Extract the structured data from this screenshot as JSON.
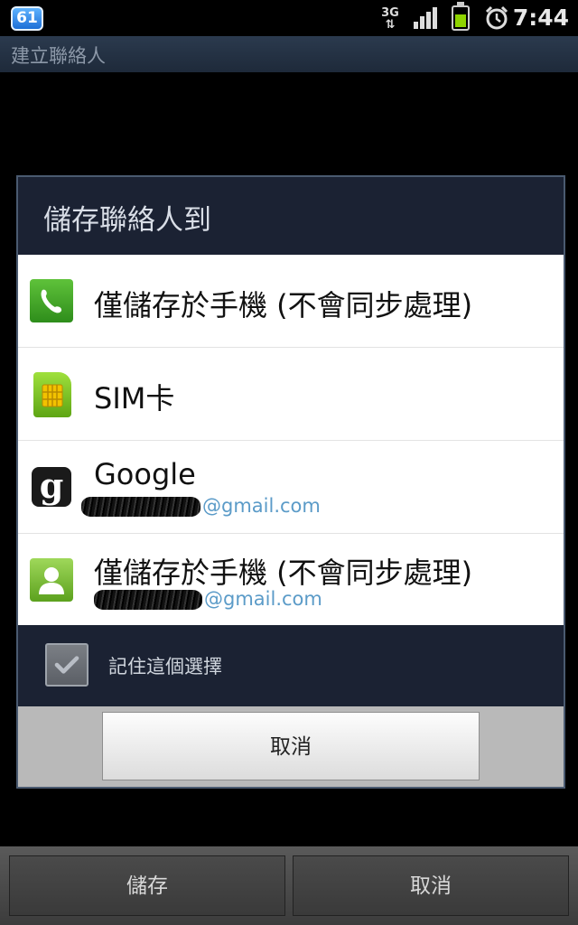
{
  "status_bar": {
    "notification_count": "61",
    "network_type": "3G",
    "time": "7:44",
    "icons": [
      "notification-badge-icon",
      "3g-data-icon",
      "signal-strength-icon",
      "battery-icon",
      "alarm-clock-icon"
    ]
  },
  "title_bar": {
    "title": "建立聯絡人"
  },
  "dialog": {
    "title": "儲存聯絡人到",
    "items": [
      {
        "label": "僅儲存於手機 (不會同步處理)",
        "account_suffix": "",
        "icon": "phone-icon"
      },
      {
        "label": "SIM卡",
        "account_suffix": "",
        "icon": "sim-card-icon"
      },
      {
        "label": "Google",
        "account_suffix": "@gmail.com",
        "icon": "google-icon"
      },
      {
        "label": "僅儲存於手機 (不會同步處理)",
        "account_suffix": "@gmail.com",
        "icon": "contact-icon"
      }
    ],
    "remember_label": "記住這個選擇",
    "remember_checked": true,
    "cancel_label": "取消"
  },
  "bottom_bar": {
    "save_label": "儲存",
    "cancel_label": "取消"
  },
  "colors": {
    "accent_link": "#5b9bc8",
    "dialog_bg": "#1b2233",
    "list_bg": "#ffffff"
  }
}
